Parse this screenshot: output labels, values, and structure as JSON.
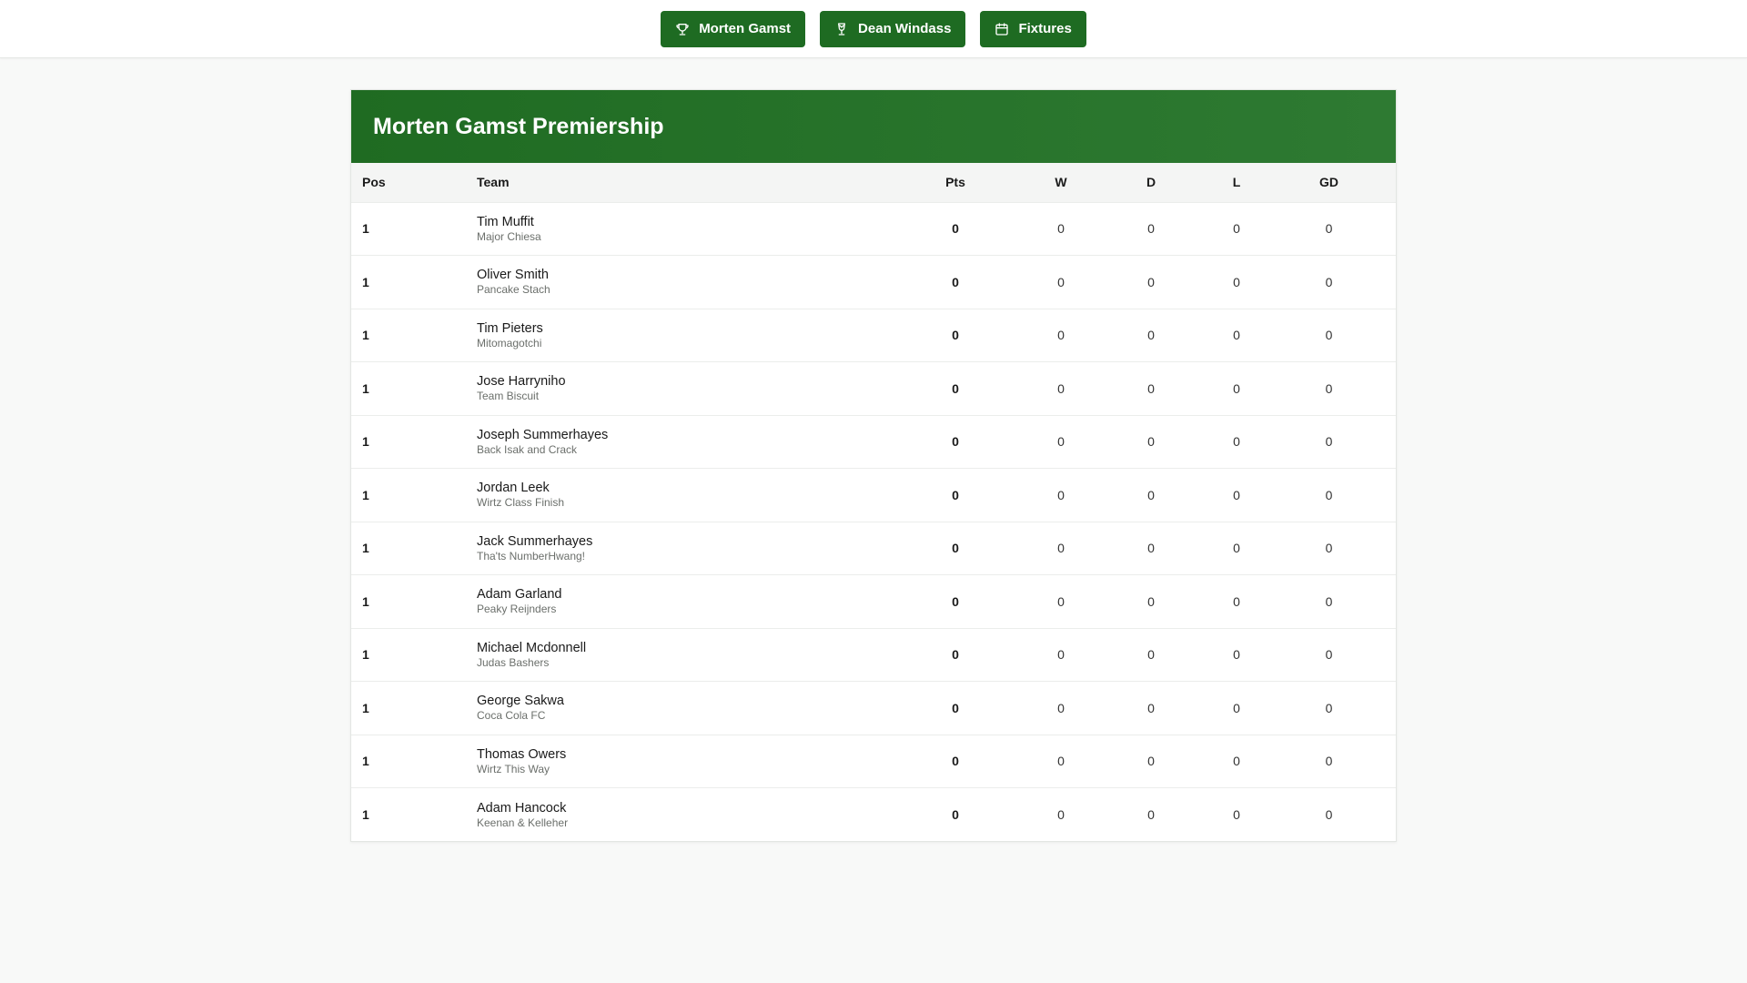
{
  "nav": {
    "buttons": [
      {
        "label": "Morten Gamst",
        "icon": "trophy-icon"
      },
      {
        "label": "Dean Windass",
        "icon": "trophy-outline-icon"
      },
      {
        "label": "Fixtures",
        "icon": "calendar-icon"
      }
    ]
  },
  "league": {
    "title": "Morten Gamst Premiership",
    "columns": {
      "pos": "Pos",
      "team": "Team",
      "pts": "Pts",
      "w": "W",
      "d": "D",
      "l": "L",
      "gd": "GD"
    },
    "rows": [
      {
        "pos": "1",
        "manager": "Tim Muffit",
        "team": "Major Chiesa",
        "pts": "0",
        "w": "0",
        "d": "0",
        "l": "0",
        "gd": "0"
      },
      {
        "pos": "1",
        "manager": "Oliver Smith",
        "team": "Pancake Stach",
        "pts": "0",
        "w": "0",
        "d": "0",
        "l": "0",
        "gd": "0"
      },
      {
        "pos": "1",
        "manager": "Tim Pieters",
        "team": "Mitomagotchi",
        "pts": "0",
        "w": "0",
        "d": "0",
        "l": "0",
        "gd": "0"
      },
      {
        "pos": "1",
        "manager": "Jose Harryniho",
        "team": "Team Biscuit",
        "pts": "0",
        "w": "0",
        "d": "0",
        "l": "0",
        "gd": "0"
      },
      {
        "pos": "1",
        "manager": "Joseph Summerhayes",
        "team": "Back Isak and Crack",
        "pts": "0",
        "w": "0",
        "d": "0",
        "l": "0",
        "gd": "0"
      },
      {
        "pos": "1",
        "manager": "Jordan Leek",
        "team": "Wirtz Class Finish",
        "pts": "0",
        "w": "0",
        "d": "0",
        "l": "0",
        "gd": "0"
      },
      {
        "pos": "1",
        "manager": "Jack Summerhayes",
        "team": "Tha'ts NumberHwang!",
        "pts": "0",
        "w": "0",
        "d": "0",
        "l": "0",
        "gd": "0"
      },
      {
        "pos": "1",
        "manager": "Adam Garland",
        "team": "Peaky Reijnders",
        "pts": "0",
        "w": "0",
        "d": "0",
        "l": "0",
        "gd": "0"
      },
      {
        "pos": "1",
        "manager": "Michael Mcdonnell",
        "team": "Judas Bashers",
        "pts": "0",
        "w": "0",
        "d": "0",
        "l": "0",
        "gd": "0"
      },
      {
        "pos": "1",
        "manager": "George Sakwa",
        "team": "Coca Cola FC",
        "pts": "0",
        "w": "0",
        "d": "0",
        "l": "0",
        "gd": "0"
      },
      {
        "pos": "1",
        "manager": "Thomas Owers",
        "team": "Wirtz This Way",
        "pts": "0",
        "w": "0",
        "d": "0",
        "l": "0",
        "gd": "0"
      },
      {
        "pos": "1",
        "manager": "Adam Hancock",
        "team": "Keenan & Kelleher",
        "pts": "0",
        "w": "0",
        "d": "0",
        "l": "0",
        "gd": "0"
      }
    ]
  },
  "colors": {
    "accent": "#1e6b22",
    "background": "#f8f9f8"
  }
}
